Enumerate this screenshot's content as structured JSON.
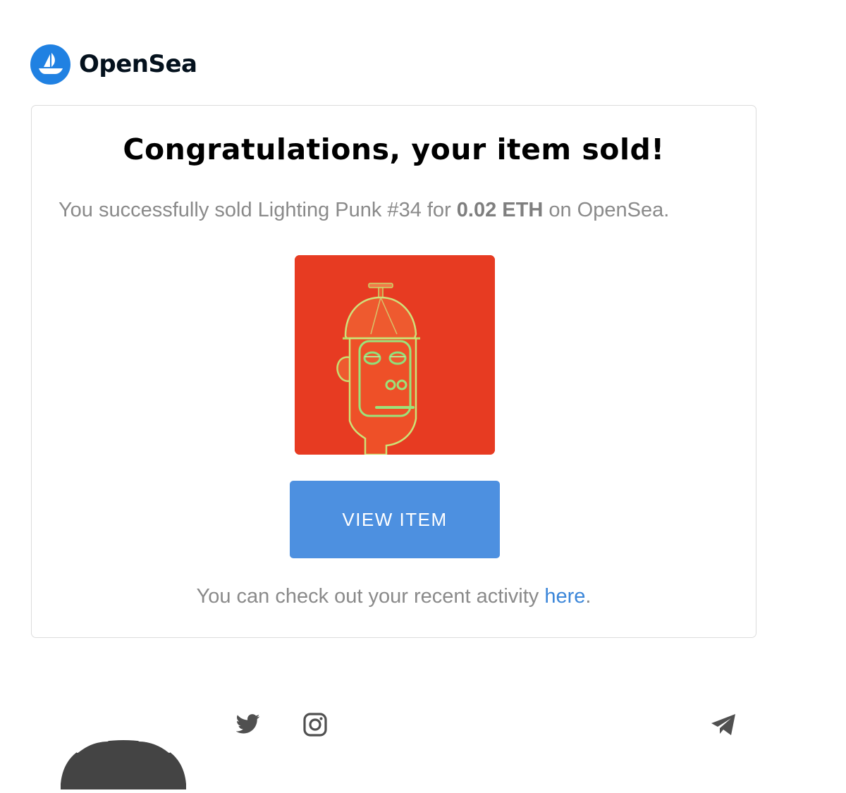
{
  "brand": {
    "name": "OpenSea",
    "color": "#2081e2"
  },
  "email": {
    "title": "Congratulations, your item sold!",
    "message_prefix": "You successfully sold Lighting Punk #34 for ",
    "price": "0.02 ETH",
    "message_suffix": " on OpenSea.",
    "button_label": "VIEW ITEM",
    "activity_prefix": "You can check out your recent activity ",
    "activity_link": "here",
    "activity_suffix": "."
  },
  "nft": {
    "icon": "nft-punk-image",
    "background_color": "#e73b22"
  },
  "footer": {
    "social_icons": [
      "twitter-icon",
      "instagram-icon",
      "telegram-icon"
    ]
  },
  "colors": {
    "button": "#4d90e0",
    "link": "#3b86d9",
    "muted_text": "#8a8a8a"
  }
}
